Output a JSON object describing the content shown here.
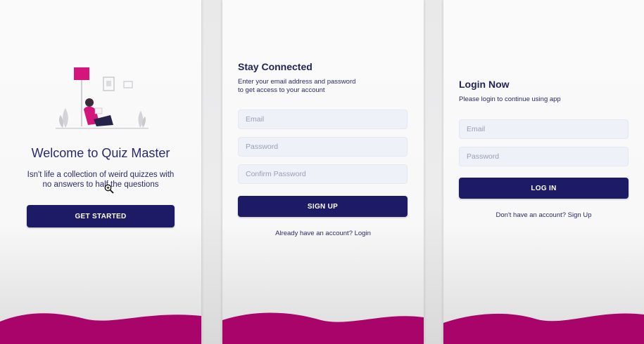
{
  "colors": {
    "primary": "#1e1b66",
    "wave": "#a8046a",
    "text": "#2a2a6a",
    "field_bg": "#eef1f8",
    "placeholder": "#9aa0b4"
  },
  "welcome": {
    "title": "Welcome to Quiz Master",
    "subtitle_line1": "Isn't life a collection of weird quizzes with",
    "subtitle_line2": "no answers to half the questions",
    "button": "GET STARTED"
  },
  "signup": {
    "title": "Stay Connected",
    "subtitle_line1": "Enter your email address and password",
    "subtitle_line2": "to get access to your account",
    "email_placeholder": "Email",
    "password_placeholder": "Password",
    "confirm_placeholder": "Confirm Password",
    "button": "SIGN UP",
    "alt_link": "Already have an account? Login"
  },
  "login": {
    "title": "Login Now",
    "subtitle": "Please login to continue using app",
    "email_placeholder": "Email",
    "password_placeholder": "Password",
    "button": "LOG IN",
    "alt_link": "Don't have an account? Sign Up"
  }
}
